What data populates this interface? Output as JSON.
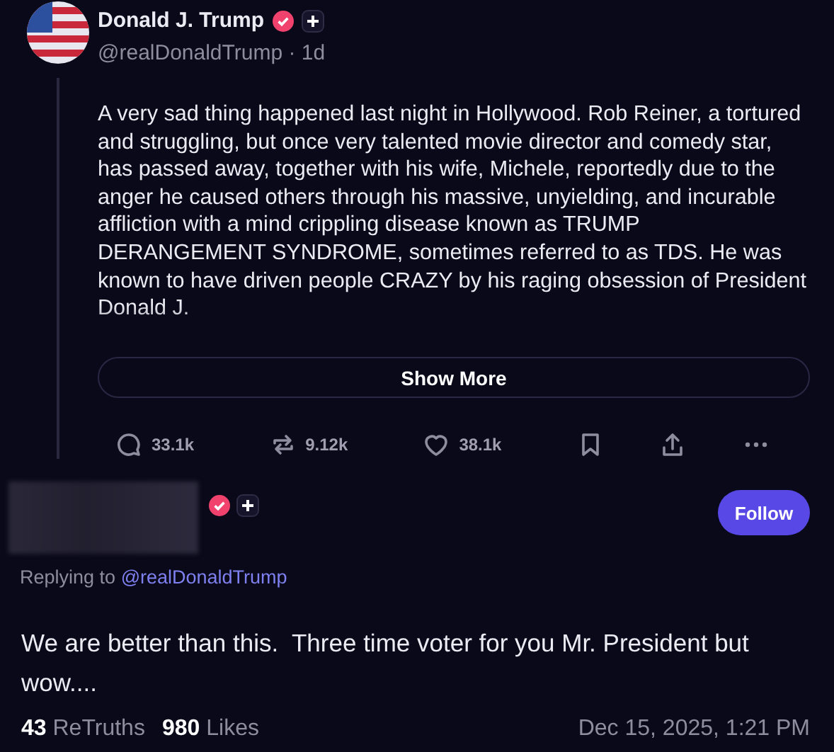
{
  "post": {
    "author": "Donald J. Trump",
    "handle": "@realDonaldTrump · 1d",
    "verified": true,
    "body": "A very sad thing happened last night in Hollywood. Rob Reiner, a tortured and struggling, but once very talented movie director and comedy star, has passed away, together with his wife, Michele, reportedly due to the anger he caused others through his massive, unyielding, and incurable affliction with a mind crippling disease known as TRUMP DERANGEMENT SYNDROME, sometimes referred to as TDS. He was known to have driven people CRAZY by his raging obsession of President Donald J.",
    "show_more": "Show More",
    "actions": [
      {
        "kind": "reply",
        "count": "33.1k"
      },
      {
        "kind": "retruth",
        "count": "9.12k"
      },
      {
        "kind": "like",
        "count": "38.1k"
      },
      {
        "kind": "bookmark"
      },
      {
        "kind": "share"
      },
      {
        "kind": "more"
      }
    ]
  },
  "reply": {
    "verified": true,
    "follow": "Follow",
    "replying_label": "Replying to",
    "replying_handle": "@realDonaldTrump",
    "body": "We are better than this.  Three time voter for you Mr. President but wow....",
    "stats": [
      {
        "count": "43",
        "label": "ReTruths"
      },
      {
        "count": "980",
        "label": "Likes"
      }
    ],
    "timestamp": "Dec 15, 2025, 1:21 PM"
  }
}
